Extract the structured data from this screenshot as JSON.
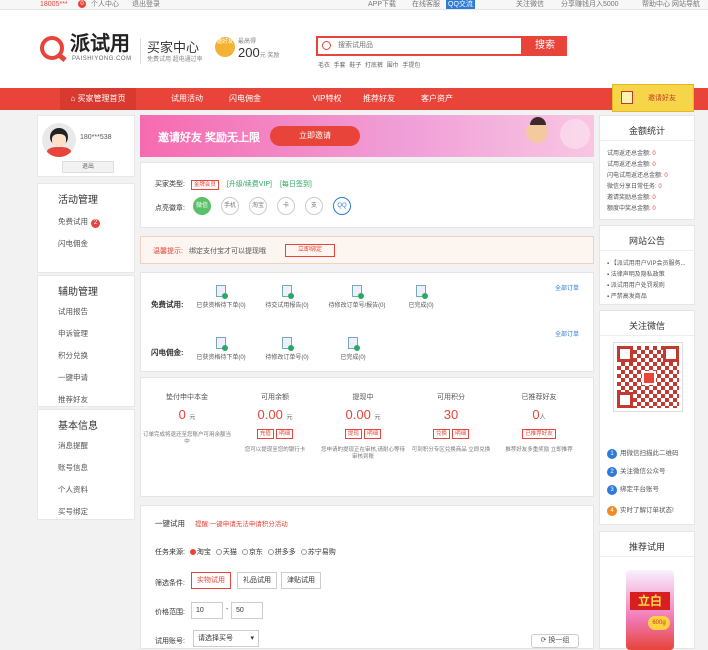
{
  "topbar": {
    "user": "18005***",
    "notice_count": "0",
    "personal_center": "个人中心",
    "logout": "退出登录",
    "app_download": "APP下载",
    "online_service": "在线客服",
    "qq_service": "QQ交流",
    "follow_wechat": "关注微信",
    "share_earn": "分享赚钱月入5000",
    "help": "帮助中心",
    "site_nav": "网站导航"
  },
  "header": {
    "logo_text": "派试用",
    "logo_domain": "PAISHIYONG.COM",
    "center_title": "买家中心",
    "center_sub": "免费试用 超电通过率",
    "invite_badge": "邀好友",
    "reward_label": "最高得",
    "reward_value": "200",
    "reward_unit": "元 奖励",
    "search_placeholder": "搜索试用品",
    "search_button": "搜索",
    "hot_words": "毛衣 手套 鞋子 打底裤 围巾 手提包"
  },
  "nav": {
    "items": [
      "买家管理首页",
      "试用活动",
      "闪电佣金",
      "VIP特权",
      "推荐好友",
      "客户资产"
    ],
    "invite_button": "邀请好友"
  },
  "left": {
    "username": "180***538",
    "logout": "退出",
    "activity_title": "活动管理",
    "free_trial": "免费试用",
    "free_trial_count": "2",
    "flash_commission": "闪电佣金",
    "aux_title": "辅助管理",
    "aux_items": [
      "试用报告",
      "申诉管理",
      "积分兑换",
      "一键申请",
      "推荐好友"
    ],
    "basic_title": "基本信息",
    "basic_items": [
      "消息提醒",
      "账号信息",
      "个人资料",
      "买号绑定"
    ]
  },
  "banner": {
    "text": "邀请好友 奖励无上限",
    "button": "立即邀请"
  },
  "buyer_info": {
    "type_label": "买家类型:",
    "gold": "金牌会员",
    "upgrade": "[升级/续费VIP]",
    "daily_sign": "[每日签到]",
    "badges_label": "点亮徽章:",
    "badges": [
      "微信",
      "手机",
      "淘宝",
      "卡",
      "支",
      "QQ"
    ]
  },
  "notice": {
    "label": "温馨提示:",
    "text": "绑定支付宝才可以提现哦",
    "button": "立即绑定"
  },
  "orders": {
    "free_label": "免费试用:",
    "free_steps": [
      "已获资格待下单(0)",
      "待交试用报告(0)",
      "待修改订单号/报告(0)",
      "已完成(0)"
    ],
    "all_orders": "全部订单",
    "flash_label": "闪电佣金:",
    "flash_steps": [
      "已获资格待下单(0)",
      "待修改订单号(0)",
      "已完成(0)"
    ]
  },
  "stats": [
    {
      "title": "垫付申中本金",
      "value": "0",
      "unit": "元",
      "desc": "订单完成将退还至您账户可用余额当中",
      "buttons": []
    },
    {
      "title": "可用余额",
      "value": "0.00",
      "unit": "元",
      "desc": "您可以提现至您的银行卡",
      "buttons": [
        "充值",
        "明细"
      ]
    },
    {
      "title": "提现中",
      "value": "0.00",
      "unit": "元",
      "desc": "您申请的提现正在审核,请耐心等待审核到账",
      "buttons": [
        "提现",
        "明细"
      ]
    },
    {
      "title": "可用积分",
      "value": "30",
      "unit": "",
      "desc": "可到积分专区兑换商品 立即兑换",
      "buttons": [
        "兑换",
        "明细"
      ]
    },
    {
      "title": "已推荐好友",
      "value": "0",
      "unit": "人",
      "desc": "推荐好友多重奖励 立即推荐",
      "buttons": [
        "已推荐好友"
      ]
    }
  ],
  "one_click": {
    "title": "一键试用",
    "tip": "提醒:一键申请无法申请积分活动",
    "source_label": "任务来源:",
    "sources": [
      "淘宝",
      "天猫",
      "京东",
      "拼多多",
      "苏宁易购"
    ],
    "filter_label": "筛选条件:",
    "filters": [
      "实物试用",
      "礼品试用",
      "津贴试用"
    ],
    "price_label": "价格范围:",
    "price_min": "10",
    "price_sep": "-",
    "price_max": "50",
    "account_label": "试用账号:",
    "account_select": "请选择买号",
    "refresh": "换一组"
  },
  "right": {
    "amount_title": "金额统计",
    "amount_rows": [
      {
        "label": "试用返还总金额:",
        "value": "0"
      },
      {
        "label": "试用返还总金额:",
        "value": "0"
      },
      {
        "label": "闪电试用返还总金额:",
        "value": "0"
      },
      {
        "label": "微信分享日常任务:",
        "value": "0"
      },
      {
        "label": "邀请奖励总金额:",
        "value": "0"
      },
      {
        "label": "额度中奖总金额:",
        "value": "0"
      }
    ],
    "announce_title": "网站公告",
    "announcements": [
      "【派试用用户VIP会员服务...",
      "法律声明及隐私政策",
      "派试用用户处罚规则",
      "严禁高发商品"
    ],
    "wechat_title": "关注微信",
    "wechat_steps": [
      "用微信扫描此二维码",
      "关注微信公众号",
      "绑定平台账号",
      "实时了解订单状态!"
    ],
    "recommend_title": "推荐试用",
    "product_text": "立白",
    "product_price": "600g"
  },
  "colors": {
    "accent": "#e8443a",
    "gold": "#f7d549",
    "banner": "#f45ba0"
  }
}
